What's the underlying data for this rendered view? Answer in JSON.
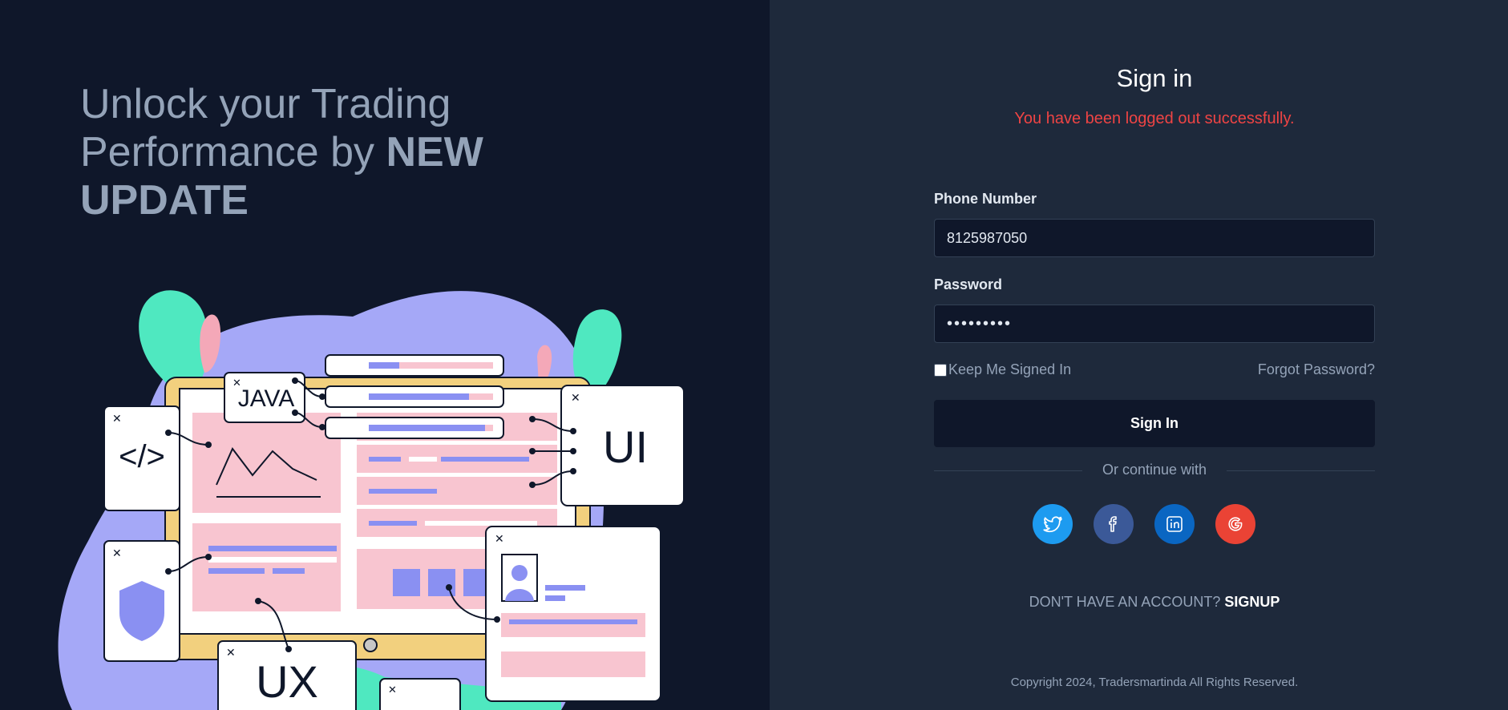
{
  "hero": {
    "headline_part1": "Unlock your Trading Performance by ",
    "headline_part2": "NEW UPDATE",
    "illustration_labels": {
      "code": "</>",
      "java": "JAVA",
      "ui": "UI",
      "ux": "UX"
    }
  },
  "signin": {
    "title": "Sign in",
    "status_message": "You have been logged out successfully.",
    "phone_label": "Phone Number",
    "phone_value": "8125987050",
    "password_label": "Password",
    "password_value": "•••••••••",
    "remember_label": "Keep Me Signed In",
    "forgot_label": "Forgot Password?",
    "submit_label": "Sign In",
    "divider_text": "Or continue with"
  },
  "social": [
    {
      "name": "twitter-icon",
      "color": "#1d9bf0"
    },
    {
      "name": "facebook-icon",
      "color": "#3b5998"
    },
    {
      "name": "linkedin-icon",
      "color": "#0a66c2"
    },
    {
      "name": "google-icon",
      "color": "#ea4335"
    }
  ],
  "signup": {
    "prompt": "DON'T HAVE AN ACCOUNT? ",
    "link": "SIGNUP"
  },
  "footer": {
    "copyright": "Copyright 2024, Tradersmartinda All Rights Reserved."
  }
}
